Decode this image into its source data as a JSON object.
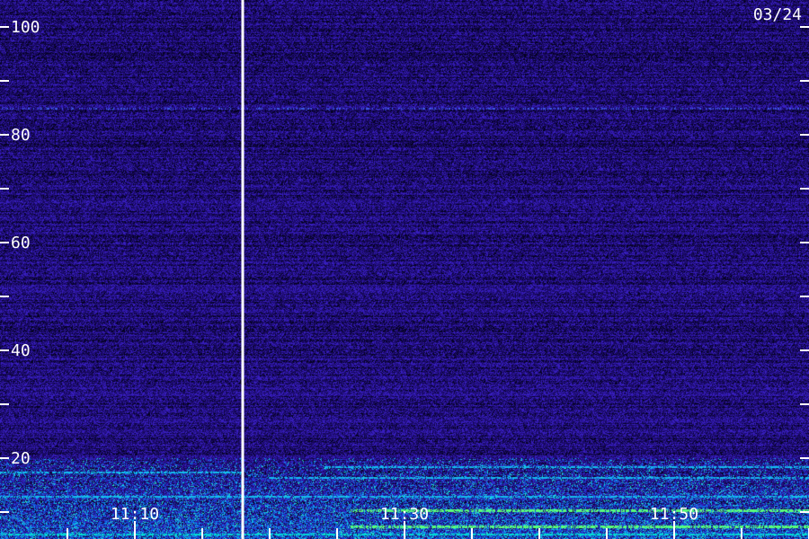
{
  "chart_data": {
    "type": "heatmap",
    "date_label": "03/24",
    "y_axis": {
      "ylim": [
        0,
        100
      ],
      "labeled_ticks": [
        20,
        40,
        60,
        80,
        100
      ],
      "tick_labels": [
        "20",
        "40",
        "60",
        "80",
        "100"
      ],
      "minor_ticks": [
        10,
        30,
        50,
        70,
        90
      ]
    },
    "x_axis": {
      "labeled_ticks": [
        "11:10",
        "11:30",
        "11:50"
      ],
      "tick_minutes": [
        10,
        30,
        50
      ],
      "minor_tick_minutes": [
        5,
        15,
        20,
        25,
        35,
        40,
        45,
        55,
        60
      ]
    },
    "time_marker": {
      "minute": 18
    },
    "frequency_bands": [
      {
        "y": 2,
        "start_minute": 0,
        "end_minute": 60,
        "intensity": "high"
      },
      {
        "y": 4,
        "start_minute": 0,
        "end_minute": 60,
        "intensity": "high"
      },
      {
        "y": 6,
        "start_minute": 0,
        "end_minute": 60,
        "intensity": "high"
      },
      {
        "y": 7.5,
        "start_minute": 26,
        "end_minute": 60,
        "intensity": "very high"
      },
      {
        "y": 10.5,
        "start_minute": 26,
        "end_minute": 60,
        "intensity": "very high"
      },
      {
        "y": 13,
        "start_minute": 0,
        "end_minute": 60,
        "intensity": "medium"
      },
      {
        "y": 16.5,
        "start_minute": 20,
        "end_minute": 60,
        "intensity": "medium"
      },
      {
        "y": 18.5,
        "start_minute": 24,
        "end_minute": 60,
        "intensity": "medium"
      },
      {
        "y": 17.5,
        "start_minute": 0,
        "end_minute": 18,
        "intensity": "medium"
      },
      {
        "y": 85,
        "start_minute": 0,
        "end_minute": 60,
        "intensity": "low"
      }
    ],
    "colors": {
      "background": "#1a0a6e",
      "noise_low": "#0a0530",
      "noise_high": "#3a22c8",
      "signal_mid": "#1aa0ff",
      "signal_high": "#00e0d0",
      "signal_peak": "#60ff80",
      "axis": "#ffffff"
    }
  }
}
